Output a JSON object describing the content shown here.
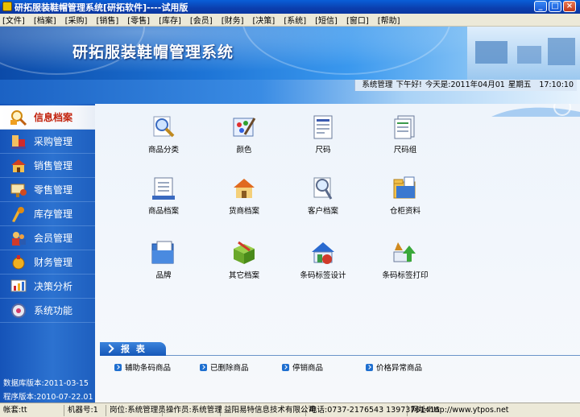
{
  "window": {
    "title": "研拓服装鞋帽管理系统[研拓软件]----试用版",
    "minimize": "_",
    "maximize": "□",
    "close": "×"
  },
  "menu": [
    "[文件]",
    "[档案]",
    "[采购]",
    "[销售]",
    "[零售]",
    "[库存]",
    "[会员]",
    "[财务]",
    "[决策]",
    "[系统]",
    "[短信]",
    "[窗口]",
    "[帮助]"
  ],
  "banner": {
    "title": "研拓服装鞋帽管理系统"
  },
  "status_info": {
    "user": "系统管理",
    "greeting": "下午好!",
    "today": "今天是:2011年04月01",
    "weekday": "星期五",
    "time": "17:10:10"
  },
  "sidebar": {
    "items": [
      {
        "label": "信息档案",
        "icon": "info-archive-icon",
        "active": true
      },
      {
        "label": "采购管理",
        "icon": "purchase-icon",
        "active": false
      },
      {
        "label": "销售管理",
        "icon": "sales-icon",
        "active": false
      },
      {
        "label": "零售管理",
        "icon": "retail-icon",
        "active": false
      },
      {
        "label": "库存管理",
        "icon": "inventory-icon",
        "active": false
      },
      {
        "label": "会员管理",
        "icon": "member-icon",
        "active": false
      },
      {
        "label": "财务管理",
        "icon": "finance-icon",
        "active": false
      },
      {
        "label": "决策分析",
        "icon": "decision-icon",
        "active": false
      },
      {
        "label": "系统功能",
        "icon": "system-icon",
        "active": false
      }
    ],
    "db_version": "数据库版本:2011-03-15",
    "app_version": "程序版本:2010-07-22.01"
  },
  "tiles": [
    {
      "label": "商品分类",
      "icon": "category-search-icon"
    },
    {
      "label": "颜色",
      "icon": "color-palette-icon"
    },
    {
      "label": "尺码",
      "icon": "size-document-icon"
    },
    {
      "label": "尺码组",
      "icon": "size-group-icon"
    },
    {
      "label": "商品档案",
      "icon": "product-file-icon"
    },
    {
      "label": "货商档案",
      "icon": "supplier-icon"
    },
    {
      "label": "客户档案",
      "icon": "customer-icon"
    },
    {
      "label": "仓柜资料",
      "icon": "warehouse-folder-icon"
    },
    {
      "label": "品牌",
      "icon": "brand-folder-icon"
    },
    {
      "label": "其它档案",
      "icon": "other-box-icon"
    },
    {
      "label": "条码标签设计",
      "icon": "barcode-design-icon"
    },
    {
      "label": "条码标签打印",
      "icon": "barcode-print-icon"
    }
  ],
  "reports": {
    "title": "报 表",
    "links": [
      "辅助条码商品",
      "已删除商品",
      "停销商品",
      "价格异常商品"
    ]
  },
  "statusbar": {
    "account": "帐套:tt",
    "machine": "机器号:1",
    "post": "岗位:系统管理员",
    "operator": "操作员:系统管理",
    "company": "益阳易特信息技术有限公司",
    "phone": "电话:0737-2176543 13973761416",
    "website": "网址:http://www.ytpos.net"
  },
  "colors": {
    "sidebar_blue": "#2c72d0",
    "active_red": "#c2220c",
    "content_bg": "#eef4fb"
  }
}
